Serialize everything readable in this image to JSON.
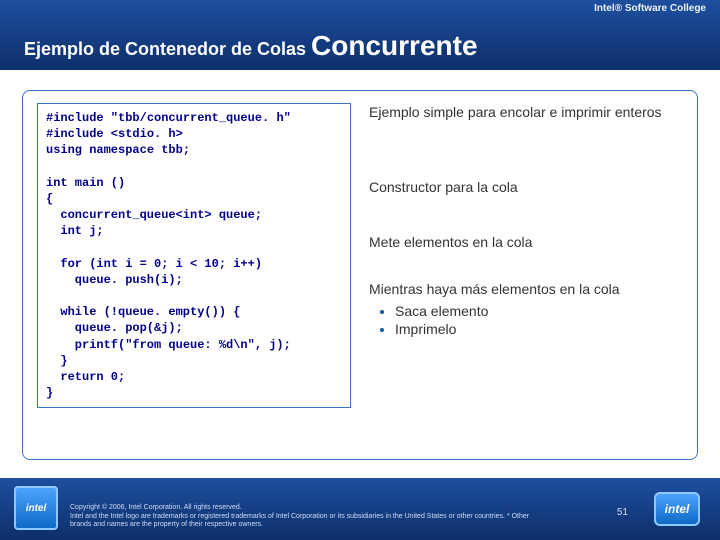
{
  "header": {
    "college": "Intel® Software College",
    "title_plain": "Ejemplo de Contenedor de Colas ",
    "title_big": "Concurrente"
  },
  "code": {
    "l1": "#include \"tbb/concurrent_queue. h\"",
    "l2": "#include <stdio. h>",
    "l3": "using namespace tbb;",
    "l4": "int main ()",
    "l5": "{",
    "l6": "concurrent_queue<int> queue;",
    "l7": "int j;",
    "l8": "for (int i = 0; i < 10; i++)",
    "l9": "queue. push(i);",
    "l10": "while (!queue. empty()) {",
    "l11": "queue. pop(&j);",
    "l12": "printf(\"from queue: %d\\n\", j);",
    "l13": "}",
    "l14": "return 0;",
    "l15": "}"
  },
  "captions": {
    "c1": "Ejemplo simple para encolar e imprimir enteros",
    "c2": "Constructor para la cola",
    "c3": "Mete elementos en la cola",
    "c4": "Mientras haya más elementos en la cola",
    "b1": "Saca elemento",
    "b2": "Imprimelo"
  },
  "footer": {
    "copyright": "Copyright © 2006, Intel Corporation. All rights reserved.",
    "legal": "Intel and the Intel logo are trademarks or registered trademarks of Intel Corporation or its subsidiaries in the United States or other countries. * Other brands and names are the property of their respective owners.",
    "slide": "51",
    "badge_left": "intel",
    "badge_right": "intel"
  }
}
